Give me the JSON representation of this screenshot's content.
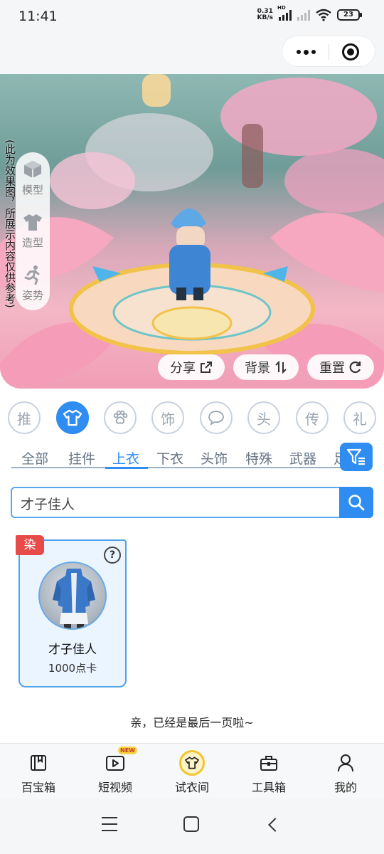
{
  "status_bar": {
    "time": "11:41",
    "net_speed_value": "0.31",
    "net_speed_unit": "KB/s",
    "hd_label": "HD",
    "battery": "23"
  },
  "preview": {
    "disclaimer": "(此为效果图，所展示内容仅供参考)",
    "side_menu": [
      {
        "label": "模型",
        "icon": "cube-icon"
      },
      {
        "label": "造型",
        "icon": "shirt-icon"
      },
      {
        "label": "姿势",
        "icon": "running-pose-icon"
      }
    ],
    "buttons": {
      "share": "分享",
      "background": "背景",
      "reset": "重置"
    }
  },
  "categories": [
    {
      "label": "推",
      "active": false
    },
    {
      "label": "",
      "icon": "shirt-icon",
      "active": true
    },
    {
      "label": "",
      "icon": "paw-icon",
      "active": false
    },
    {
      "label": "饰",
      "active": false
    },
    {
      "label": "",
      "icon": "chat-bubble-icon",
      "active": false
    },
    {
      "label": "头",
      "active": false
    },
    {
      "label": "传",
      "active": false
    },
    {
      "label": "礼",
      "active": false
    }
  ],
  "sub_tabs": [
    "全部",
    "挂件",
    "上衣",
    "下衣",
    "头饰",
    "特殊",
    "武器",
    "足"
  ],
  "active_sub_tab": "上衣",
  "search": {
    "value": "才子佳人"
  },
  "items": [
    {
      "tag": "染",
      "name": "才子佳人",
      "price": "1000点卡",
      "help": "?"
    }
  ],
  "end_text": "亲，已经是最后一页啦~",
  "bottom_nav": [
    {
      "label": "百宝箱",
      "icon": "treasure-book-icon"
    },
    {
      "label": "短视频",
      "icon": "video-play-icon",
      "badge": "NEW"
    },
    {
      "label": "试衣间",
      "icon": "fitting-room-shirt-icon",
      "active": true
    },
    {
      "label": "工具箱",
      "icon": "toolbox-icon"
    },
    {
      "label": "我的",
      "icon": "user-icon"
    }
  ],
  "colors": {
    "accent": "#2f8cf0",
    "tag_red": "#e84a4a",
    "active_yellow": "#f4c430"
  }
}
